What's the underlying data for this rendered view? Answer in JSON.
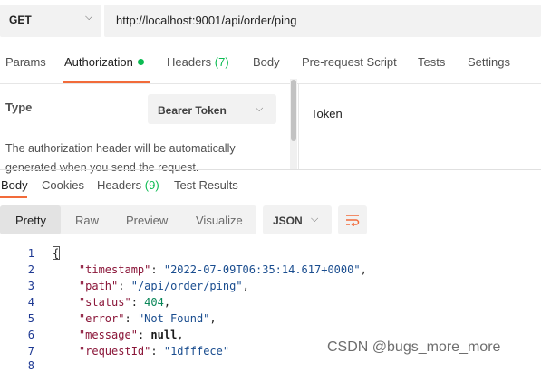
{
  "request": {
    "method": "GET",
    "url": "http://localhost:9001/api/order/ping"
  },
  "request_tabs": {
    "params": "Params",
    "authorization": "Authorization",
    "headers": "Headers",
    "headers_count": "(7)",
    "body": "Body",
    "prerequest": "Pre-request Script",
    "tests": "Tests",
    "settings": "Settings"
  },
  "auth": {
    "type_label": "Type",
    "type_value": "Bearer Token",
    "description": "The authorization header will be automatically generated when you send the request.",
    "token_label": "Token"
  },
  "response_tabs": {
    "body": "Body",
    "cookies": "Cookies",
    "headers": "Headers",
    "headers_count": "(9)",
    "test_results": "Test Results"
  },
  "view_modes": {
    "pretty": "Pretty",
    "raw": "Raw",
    "preview": "Preview",
    "visualize": "Visualize",
    "format": "JSON"
  },
  "response_body": {
    "line_numbers": [
      "1",
      "2",
      "3",
      "4",
      "5",
      "6",
      "7",
      "8"
    ],
    "open_brace": "{",
    "timestamp_key": "\"timestamp\"",
    "timestamp_value": "\"2022-07-09T06:35:14.617+0000\"",
    "path_key": "\"path\"",
    "path_value": "/api/order/ping",
    "status_key": "\"status\"",
    "status_value": "404",
    "error_key": "\"error\"",
    "error_value": "\"Not Found\"",
    "message_key": "\"message\"",
    "message_value": "null",
    "requestId_key": "\"requestId\"",
    "requestId_value": "\"1dfffece\""
  },
  "watermark": "CSDN @bugs_more_more",
  "colors": {
    "accent": "#f26b3a",
    "success": "#0cbb52",
    "panel": "#f2f2f2"
  }
}
